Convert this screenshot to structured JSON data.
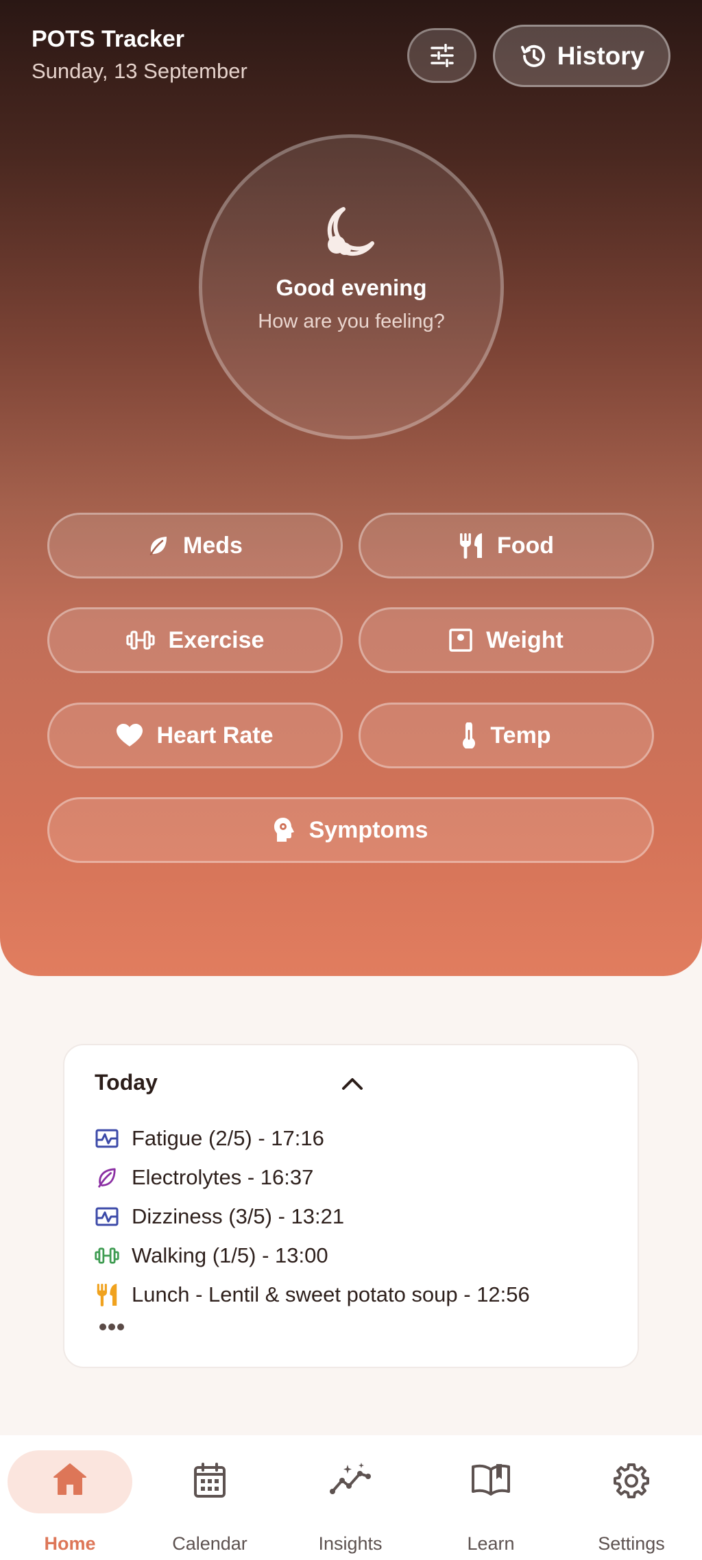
{
  "header": {
    "title": "POTS Tracker",
    "date": "Sunday, 13 September",
    "history_label": "History"
  },
  "greeting": {
    "title": "Good evening",
    "subtitle": "How are you feeling?"
  },
  "actions": {
    "meds": "Meds",
    "food": "Food",
    "exercise": "Exercise",
    "weight": "Weight",
    "heart_rate": "Heart Rate",
    "temp": "Temp",
    "symptoms": "Symptoms"
  },
  "today": {
    "title": "Today",
    "items": [
      {
        "text": "Fatigue (2/5) - 17:16",
        "icon": "symptom-chart-icon",
        "color": "#3c4aa8"
      },
      {
        "text": "Electrolytes - 16:37",
        "icon": "leaf-icon",
        "color": "#8b2fa3"
      },
      {
        "text": "Dizziness (3/5) - 13:21",
        "icon": "symptom-chart-icon",
        "color": "#3c4aa8"
      },
      {
        "text": "Walking (1/5) - 13:00",
        "icon": "dumbbell-icon",
        "color": "#3f9c52"
      },
      {
        "text": "Lunch - Lentil & sweet potato soup - 12:56",
        "icon": "fork-knife-icon",
        "color": "#f0a21e"
      }
    ]
  },
  "nav": {
    "home": "Home",
    "calendar": "Calendar",
    "insights": "Insights",
    "learn": "Learn",
    "settings": "Settings"
  },
  "colors": {
    "accent": "#dd7658",
    "hero_top": "#2a1714",
    "hero_bottom": "#e17d5f"
  }
}
